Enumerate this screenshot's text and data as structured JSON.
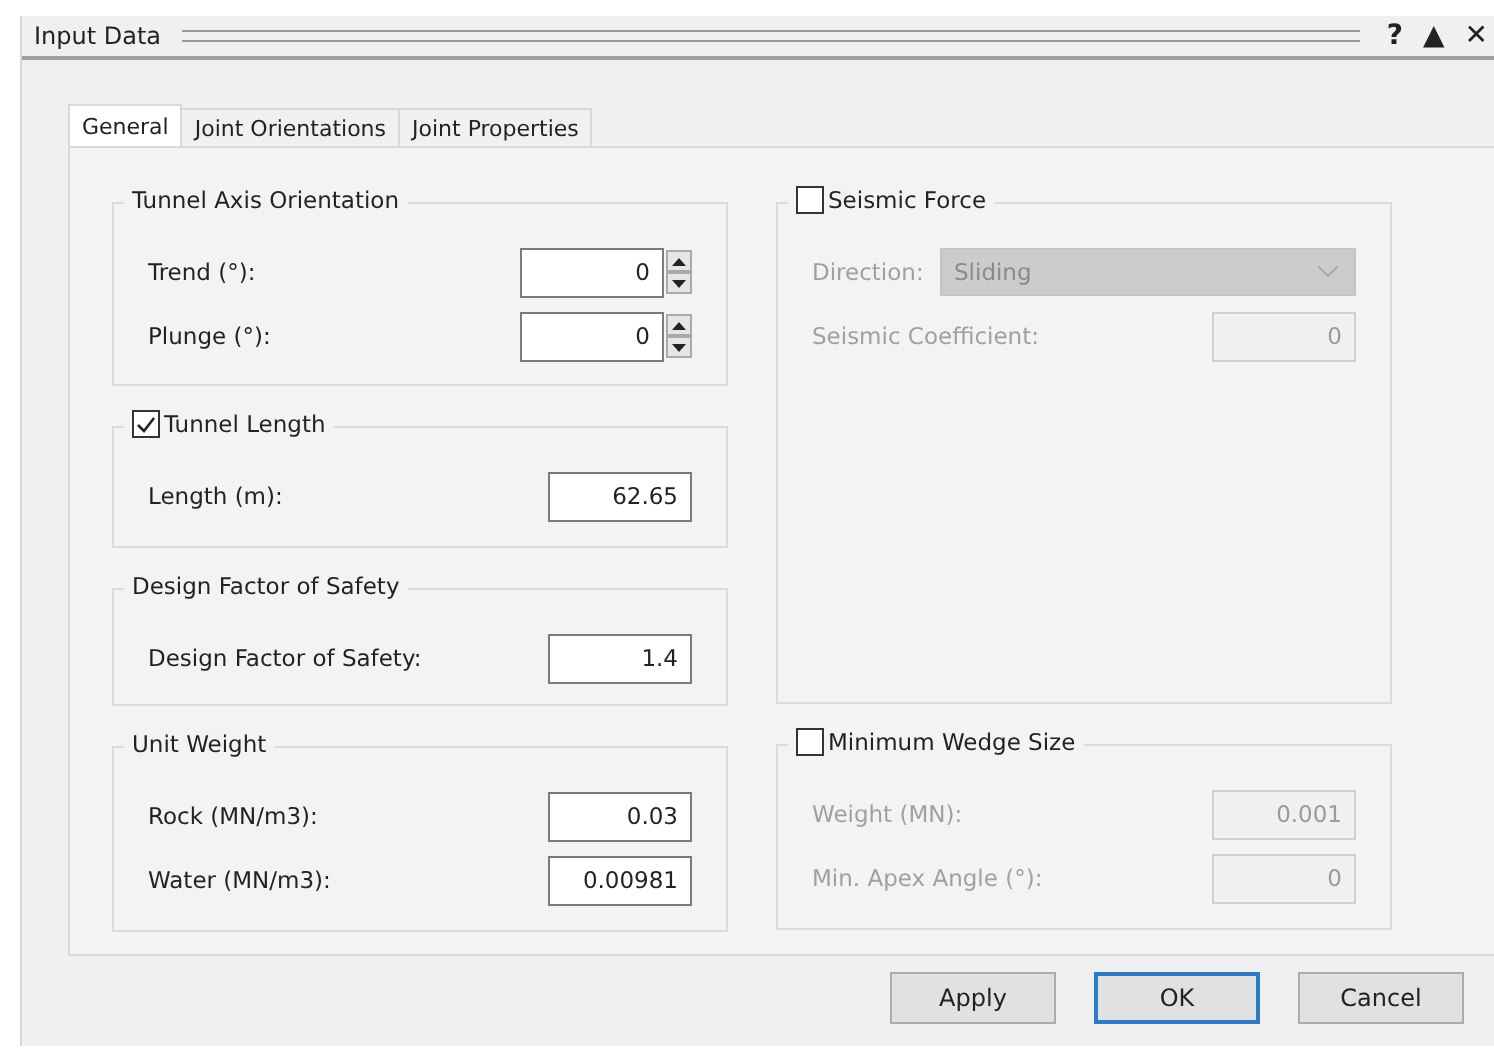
{
  "window": {
    "title": "Input Data",
    "controls": [
      "?",
      "▲",
      "✕"
    ]
  },
  "tabs": [
    {
      "label": "General",
      "selected": true
    },
    {
      "label": "Joint Orientations",
      "selected": false
    },
    {
      "label": "Joint Properties",
      "selected": false
    }
  ],
  "left_groups": [
    {
      "title": "Tunnel Axis Orientation",
      "kind": "plain",
      "fields": [
        {
          "label": "Trend (°):",
          "value": "0",
          "kind": "spin"
        },
        {
          "label": "Plunge (°):",
          "value": "0",
          "kind": "spin"
        }
      ]
    },
    {
      "title": "Tunnel Length",
      "kind": "checkbox",
      "checked": true,
      "fields": [
        {
          "label": "Length (m):",
          "value": "62.65",
          "kind": "text"
        }
      ]
    },
    {
      "title": "Design Factor of Safety",
      "kind": "plain",
      "fields": [
        {
          "label": "Design Factor of Safety:",
          "value": "1.4",
          "kind": "text"
        }
      ]
    },
    {
      "title": "Unit Weight",
      "kind": "plain",
      "fields": [
        {
          "label": "Rock (MN/m3):",
          "value": "0.03",
          "kind": "text"
        },
        {
          "label": "Water (MN/m3):",
          "value": "0.00981",
          "kind": "text"
        }
      ]
    }
  ],
  "right_groups": [
    {
      "title": "Seismic Force",
      "kind": "checkbox",
      "checked": false,
      "fields": [
        {
          "label": "Direction:",
          "value": "Sliding",
          "kind": "select"
        },
        {
          "label": "Seismic Coefficient:",
          "value": "0",
          "kind": "text"
        }
      ]
    },
    {
      "title": "Minimum Wedge Size",
      "kind": "checkbox",
      "checked": false,
      "fields": [
        {
          "label": "Weight (MN):",
          "value": "0.001",
          "kind": "text"
        },
        {
          "label": "Min. Apex Angle (°):",
          "value": "0",
          "kind": "text"
        }
      ]
    }
  ],
  "buttons": [
    {
      "label": "Apply",
      "default": false
    },
    {
      "label": "OK",
      "default": true
    },
    {
      "label": "Cancel",
      "default": false
    }
  ]
}
